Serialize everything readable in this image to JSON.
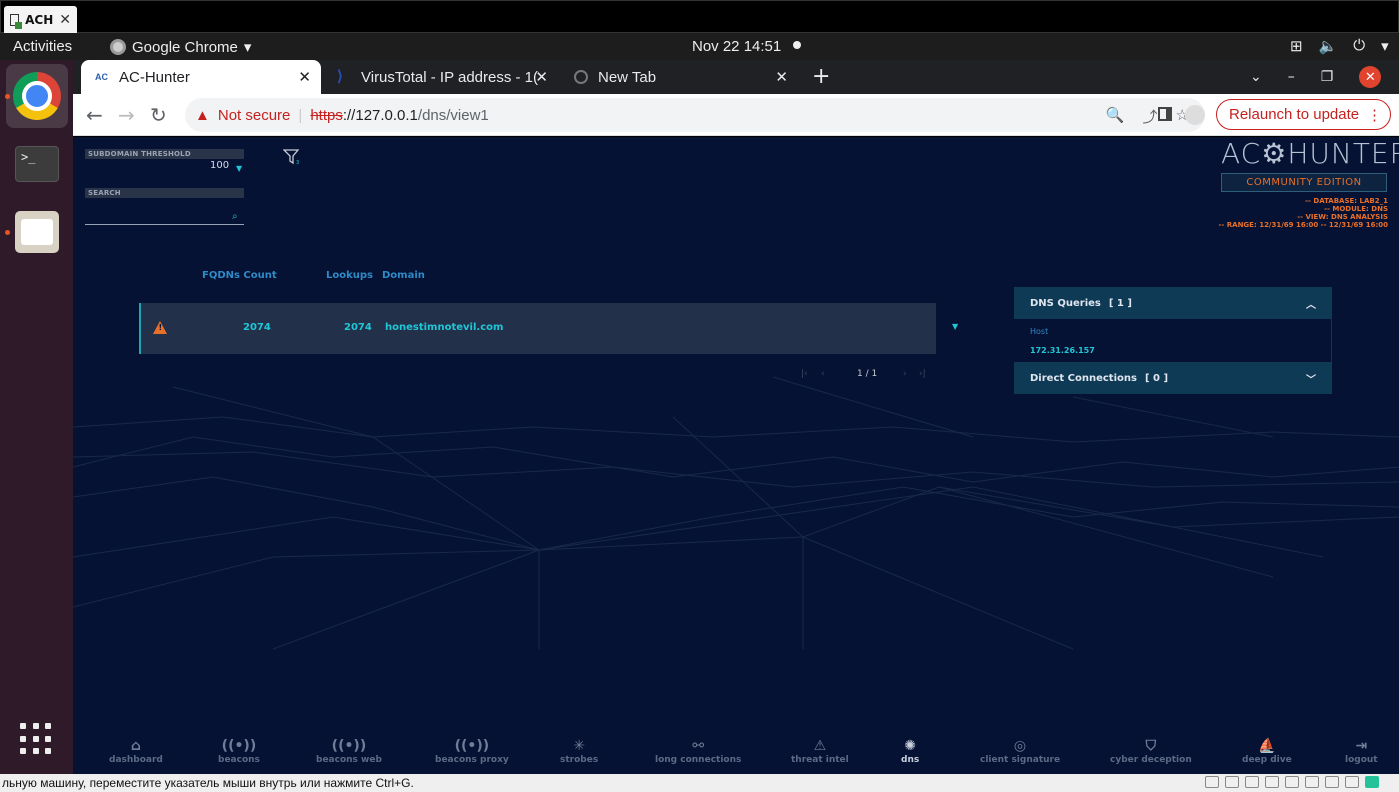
{
  "vm": {
    "tab_title": "ACH",
    "status_message": "льную машину, переместите указатель мыши внутрь или нажмите Ctrl+G."
  },
  "topbar": {
    "activities": "Activities",
    "app_name": "Google Chrome",
    "clock": "Nov 22  14:51"
  },
  "browser": {
    "tabs": [
      {
        "title": "AC-Hunter"
      },
      {
        "title": "VirusTotal - IP address - 1("
      },
      {
        "title": "New Tab"
      }
    ],
    "security_label": "Not secure",
    "url_scheme": "https",
    "url_host": "://127.0.0.1",
    "url_path": "/dns/view1",
    "relaunch_label": "Relaunch to update"
  },
  "app": {
    "controls": {
      "threshold_label": "SUBDOMAIN THRESHOLD",
      "threshold_value": "100",
      "search_label": "SEARCH",
      "search_placeholder": ""
    },
    "logo": {
      "left": "AC",
      "right": "HUNTER",
      "edition": "COMMUNITY EDITION"
    },
    "meta": {
      "database": "-- DATABASE: LAB2_1",
      "module": "-- MODULE: DNS",
      "view": "-- VIEW: DNS ANALYSIS",
      "range": "-- RANGE: 12/31/69 16:00 -- 12/31/69 16:00"
    },
    "table": {
      "headers": [
        "FQDNs Count",
        "Lookups",
        "Domain"
      ],
      "rows": [
        {
          "fqdns": "2074",
          "lookups": "2074",
          "domain": "honestimnotevil.com"
        }
      ],
      "pagination": "1 / 1"
    },
    "panel": {
      "dns_queries_title": "DNS Queries",
      "dns_queries_count": "[ 1 ]",
      "host_label": "Host",
      "host_value": "172.31.26.157",
      "direct_title": "Direct Connections",
      "direct_count": "[ 0 ]"
    },
    "nav": [
      {
        "label": "dashboard",
        "icon": "home-icon"
      },
      {
        "label": "beacons",
        "icon": "broadcast-icon"
      },
      {
        "label": "beacons web",
        "icon": "broadcast-icon"
      },
      {
        "label": "beacons proxy",
        "icon": "broadcast-icon"
      },
      {
        "label": "strobes",
        "icon": "burst-icon"
      },
      {
        "label": "long connections",
        "icon": "link-icon"
      },
      {
        "label": "threat intel",
        "icon": "warning-icon"
      },
      {
        "label": "dns",
        "icon": "network-icon"
      },
      {
        "label": "client signature",
        "icon": "fingerprint-icon"
      },
      {
        "label": "cyber deception",
        "icon": "shield-icon"
      },
      {
        "label": "deep dive",
        "icon": "sail-icon"
      },
      {
        "label": "logout",
        "icon": "logout-icon"
      }
    ],
    "active_nav": "dns"
  },
  "colors": {
    "bg": "#061233",
    "accent": "#1fc7d6",
    "warning": "#e8702a"
  }
}
